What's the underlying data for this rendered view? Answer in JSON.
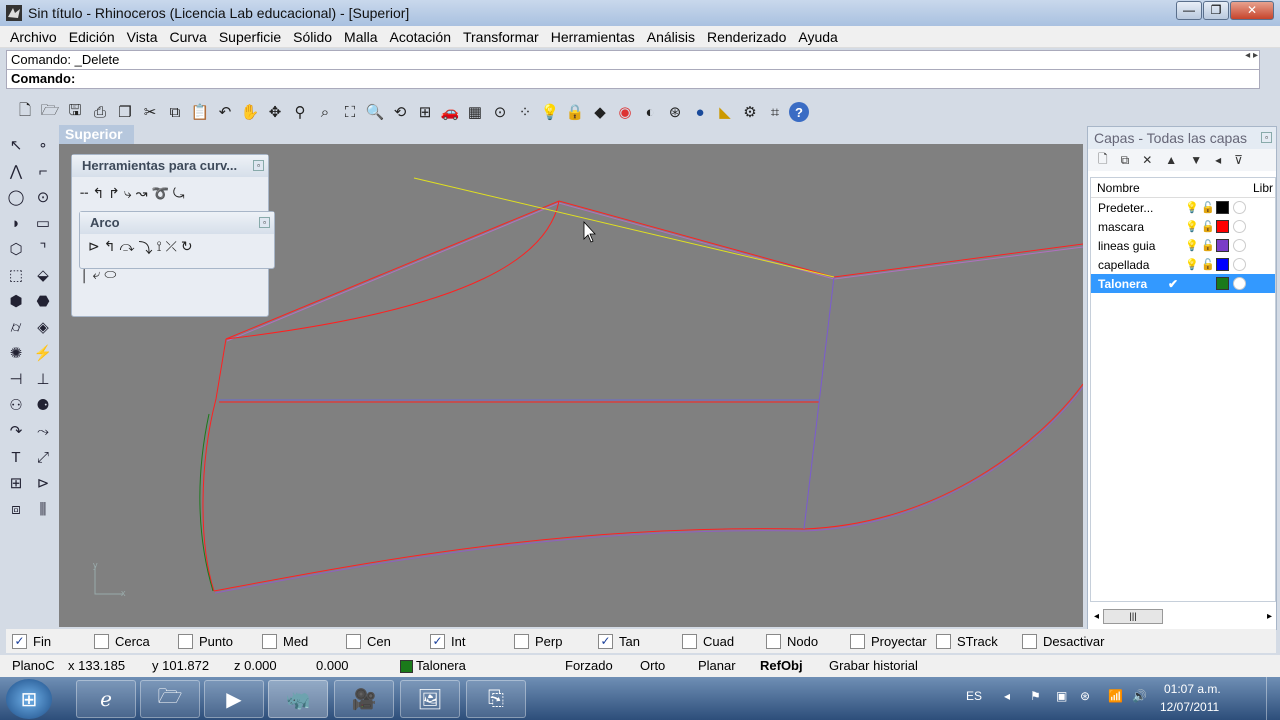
{
  "window": {
    "title": "Sin título - Rhinoceros (Licencia Lab educacional) - [Superior]",
    "min": "—",
    "max": "❐",
    "close": "✕"
  },
  "menu": [
    "Archivo",
    "Edición",
    "Vista",
    "Curva",
    "Superficie",
    "Sólido",
    "Malla",
    "Acotación",
    "Transformar",
    "Herramientas",
    "Análisis",
    "Renderizado",
    "Ayuda"
  ],
  "command": {
    "history": "Comando: _Delete",
    "prompt_label": "Comando:",
    "value": ""
  },
  "viewport": {
    "label": "Superior",
    "axis_y": "y",
    "axis_x": "x"
  },
  "panels": {
    "curve_tools": "Herramientas para curv...",
    "arc": "Arco"
  },
  "layers": {
    "title": "Capas - Todas las capas",
    "col_name": "Nombre",
    "col_free": "Libr",
    "rows": [
      {
        "name": "Predeter...",
        "color": "#000000",
        "current": false
      },
      {
        "name": "mascara",
        "color": "#ff0000",
        "current": false
      },
      {
        "name": "lineas guia",
        "color": "#7a3cc8",
        "current": false
      },
      {
        "name": "capellada",
        "color": "#0000ff",
        "current": false
      },
      {
        "name": "Talonera",
        "color": "#1a7a1a",
        "current": true
      }
    ],
    "check": "✔"
  },
  "osnaps": [
    {
      "label": "Fin",
      "checked": true
    },
    {
      "label": "Cerca",
      "checked": false
    },
    {
      "label": "Punto",
      "checked": false
    },
    {
      "label": "Med",
      "checked": false
    },
    {
      "label": "Cen",
      "checked": false
    },
    {
      "label": "Int",
      "checked": true
    },
    {
      "label": "Perp",
      "checked": false
    },
    {
      "label": "Tan",
      "checked": true
    },
    {
      "label": "Cuad",
      "checked": false
    },
    {
      "label": "Nodo",
      "checked": false
    },
    {
      "label": "Proyectar",
      "checked": false
    },
    {
      "label": "STrack",
      "checked": false
    },
    {
      "label": "Desactivar",
      "checked": false
    }
  ],
  "status": {
    "plane": "PlanoC",
    "x": "x 133.185",
    "y": "y 101.872",
    "z": "z 0.000",
    "d": "0.000",
    "layer": "Talonera",
    "layer_color": "#1a7a1a",
    "forzado": "Forzado",
    "orto": "Orto",
    "planar": "Planar",
    "refobj": "RefObj",
    "history": "Grabar historial"
  },
  "tray": {
    "lang": "ES",
    "time": "01:07 a.m.",
    "date": "12/07/2011"
  }
}
